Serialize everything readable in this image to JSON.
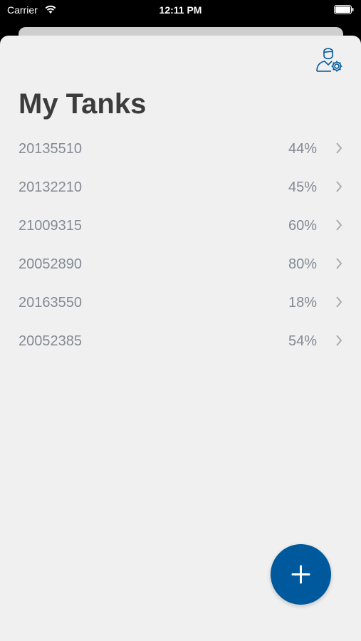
{
  "status_bar": {
    "carrier": "Carrier",
    "time": "12:11 PM"
  },
  "header": {
    "title": "My Tanks",
    "settings_icon": "user-settings-icon"
  },
  "tanks": [
    {
      "id": "20135510",
      "level": "44%"
    },
    {
      "id": "20132210",
      "level": "45%"
    },
    {
      "id": "21009315",
      "level": "60%"
    },
    {
      "id": "20052890",
      "level": "80%"
    },
    {
      "id": "20163550",
      "level": "18%"
    },
    {
      "id": "20052385",
      "level": "54%"
    }
  ],
  "colors": {
    "accent": "#00599c",
    "text_muted": "#838a93",
    "title": "#3c3c3c",
    "background": "#f0f0f0"
  },
  "fab": {
    "icon": "plus-icon"
  }
}
